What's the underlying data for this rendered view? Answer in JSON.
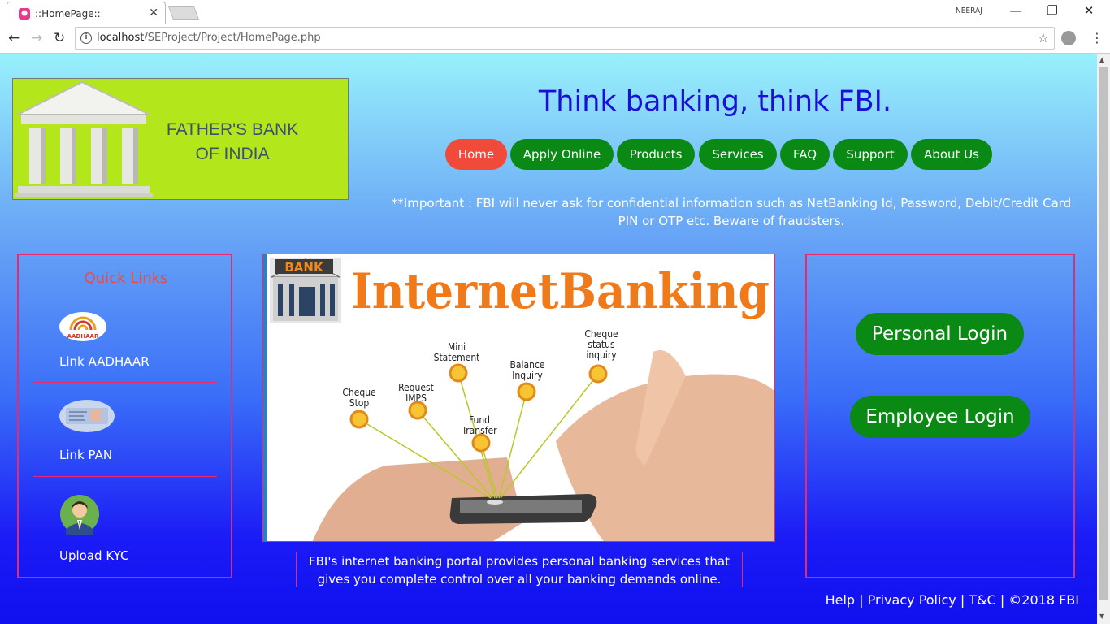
{
  "browser": {
    "tab_title": "::HomePage::",
    "tab_close": "✕",
    "profile_name": "NEERAJ",
    "url_host": "localhost",
    "url_path": "/SEProject/Project/HomePage.php",
    "window_buttons": {
      "minimize": "—",
      "restore": "❐",
      "close": "✕"
    }
  },
  "logo": {
    "line1": "FATHER'S BANK",
    "line2": "OF INDIA"
  },
  "tagline": "Think banking, think FBI.",
  "nav": {
    "items": [
      "Home",
      "Apply Online",
      "Products",
      "Services",
      "FAQ",
      "Support",
      "About Us"
    ],
    "active": "Home"
  },
  "important_notice": "**Important : FBI will never ask for confidential information such as NetBanking Id, Password, Debit/Credit Card PIN or OTP etc. Beware of fraudsters.",
  "quick_links": {
    "title": "Quick Links",
    "items": [
      "Link AADHAAR",
      "Link PAN",
      "Upload KYC"
    ],
    "aadhaar_logo_text": "AADHAAR"
  },
  "banner": {
    "bank_sign": "BANK",
    "heading": "InternetBanking",
    "labels": [
      "Cheque Stop",
      "Request IMPS",
      "Mini Statement",
      "Fund Transfer",
      "Balance Inquiry",
      "Cheque status inquiry"
    ]
  },
  "caption": "FBI's internet banking portal provides personal banking services that gives you complete control over all your banking demands online.",
  "login": {
    "personal": "Personal Login",
    "employee": "Employee Login"
  },
  "footer": {
    "help": "Help",
    "privacy": "Privacy Policy",
    "tc": "T&C",
    "copyright": "©2018 FBI",
    "sep": "|"
  },
  "colors": {
    "nav_green": "#0a8a14",
    "nav_active": "#ef4a3a",
    "border_pink": "#e9286e",
    "logo_bg": "#b4e61c",
    "tagline": "#1a10d8"
  }
}
